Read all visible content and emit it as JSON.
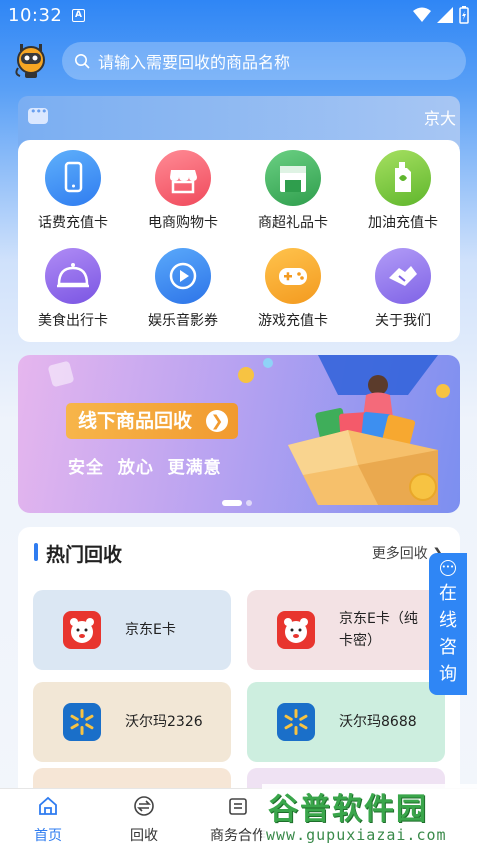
{
  "status_bar": {
    "time": "10:32"
  },
  "search": {
    "placeholder": "请输入需要回收的商品名称"
  },
  "notice": {
    "text": "京大"
  },
  "categories": [
    {
      "label": "话费充值卡",
      "icon": "phone-icon",
      "color": "#3d8ff0"
    },
    {
      "label": "电商购物卡",
      "icon": "shop-icon",
      "color": "#f45a6a"
    },
    {
      "label": "商超礼品卡",
      "icon": "store-icon",
      "color": "#3fae5a"
    },
    {
      "label": "加油充值卡",
      "icon": "fuel-icon",
      "color": "#79c93a"
    },
    {
      "label": "美食出行卡",
      "icon": "food-cloche-icon",
      "color": "#8f6fe8"
    },
    {
      "label": "娱乐音影券",
      "icon": "play-icon",
      "color": "#3b8ef0"
    },
    {
      "label": "游戏充值卡",
      "icon": "gamepad-icon",
      "color": "#f7a830"
    },
    {
      "label": "关于我们",
      "icon": "handshake-icon",
      "color": "#8e78ea"
    }
  ],
  "banner": {
    "button_label": "线下商品回收",
    "slogan": "安全  放心  更满意"
  },
  "hot": {
    "title": "热门回收",
    "more": "更多回收",
    "items": [
      {
        "name": "京东E卡",
        "bg": "#dbe7f3",
        "logo": "jd-logo-icon"
      },
      {
        "name": "京东E卡（纯卡密）",
        "bg": "#f3e2e4",
        "logo": "jd-logo-icon"
      },
      {
        "name": "沃尔玛2326",
        "bg": "#f2e7d6",
        "logo": "walmart-logo-icon"
      },
      {
        "name": "沃尔玛8688",
        "bg": "#cdeedf",
        "logo": "walmart-logo-icon"
      }
    ]
  },
  "consult": {
    "text": "在线咨询"
  },
  "nav": [
    {
      "label": "首页",
      "icon": "home-icon",
      "active": true
    },
    {
      "label": "回收",
      "icon": "exchange-icon",
      "active": false
    },
    {
      "label": "商务合作",
      "icon": "briefcase-icon",
      "active": false
    }
  ],
  "watermark": {
    "title": "谷普软件园",
    "url": "www.gupuxiazai.com"
  },
  "colors": {
    "accent": "#2f7cf0",
    "brand_blue": "#2f86f5"
  }
}
